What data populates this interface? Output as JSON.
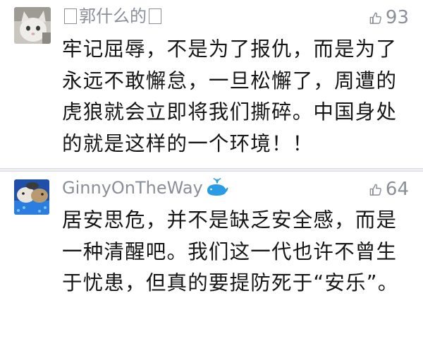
{
  "comments": [
    {
      "username": "郭什么的",
      "likes": "93",
      "text": "牢记屈辱，不是为了报仇，而是为了永远不敢懈怠，一旦松懈了，周遭的虎狼就会立即将我们撕碎。中国身处的就是这样的一个环境！！",
      "avatar_icon": "cat-avatar-icon",
      "like_icon": "thumbs-up-icon"
    },
    {
      "username": "GinnyOnTheWay",
      "likes": "64",
      "text": "居安思危，并不是缺乏安全感，而是一种清醒吧。我们这一代也许不曾生于忧患，但真的要提防死于“安乐”。",
      "avatar_icon": "hamster-avatar-icon",
      "badge_icon": "whale-icon",
      "like_icon": "thumbs-up-icon"
    }
  ],
  "colors": {
    "meta_gray": "#8a8f99",
    "text": "#161616",
    "whale_blue": "#2a9be5",
    "divider": "#eceef1"
  }
}
